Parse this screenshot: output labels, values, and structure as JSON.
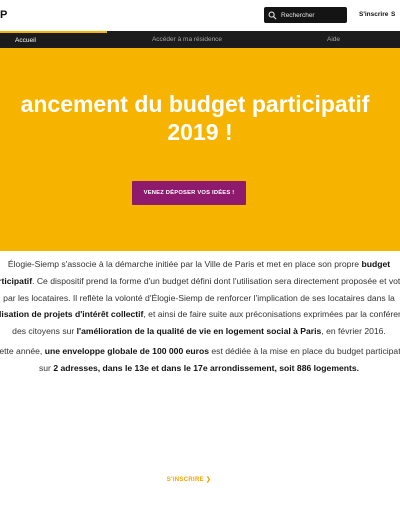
{
  "header": {
    "logo_text": "P",
    "search_placeholder": "Rechercher",
    "signup_label": "S'inscrire",
    "right_partial": "S"
  },
  "nav": {
    "tabs": [
      {
        "label": "Accueil"
      },
      {
        "label": "Accéder à ma résidence"
      },
      {
        "label": "Aide"
      }
    ]
  },
  "hero": {
    "title_line1": "ancement du budget participatif",
    "title_line2": "2019 !",
    "cta_label": "VENEZ DÉPOSER VOS IDÉES !",
    "bg_color": "#f6b400",
    "cta_color": "#8e1a6e"
  },
  "content": {
    "p1": [
      "Élogie-Siemp s'associe à la démarche initiée par la Ville de Paris et met en place son propre ",
      "budget participatif",
      ". Ce dispositif prend la forme d'un budget défini dont l'utilisation sera directement proposée et votée par les locataires. Il reflète la volonté d'Élogie-Siemp de renforcer l'implication de ses locataires dans la ",
      "réalisation de projets d'intérêt collectif",
      ", et ainsi de faire suite aux préconisations exprimées par la conférence des citoyens sur ",
      "l'amélioration de la qualité de vie en logement social à Paris",
      ", en février 2016."
    ],
    "p2": [
      "Cette année, ",
      "une enveloppe globale de 100 000 euros",
      " est dédiée à la mise en place du budget participatif sur ",
      "2 adresses, dans le 13e et dans le 17e arrondissement, soit 886 logements."
    ]
  },
  "footer_link": {
    "label": "S'INSCRIRE ❯"
  }
}
